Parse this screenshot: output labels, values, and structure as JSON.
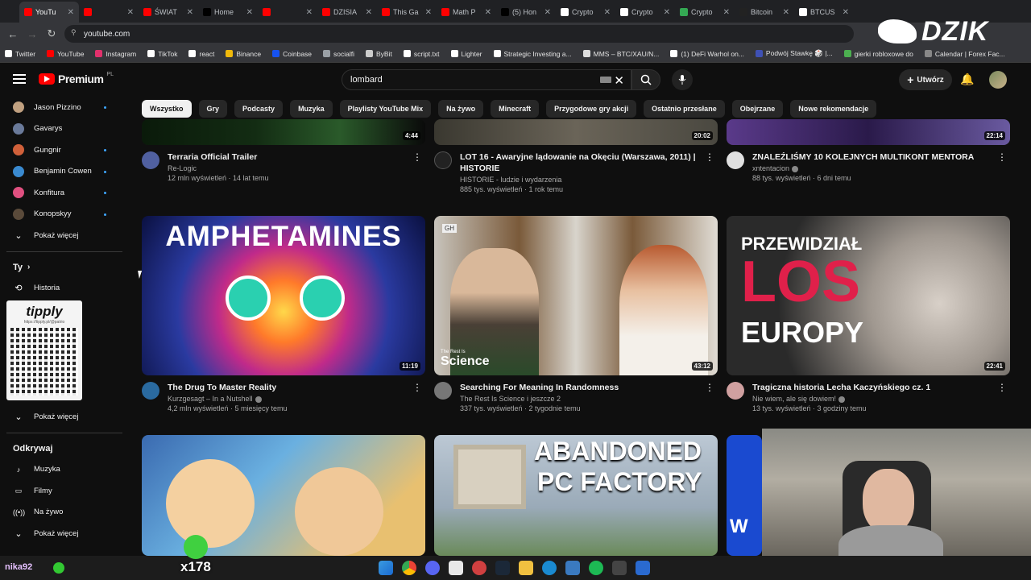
{
  "browser": {
    "tabs": [
      {
        "label": "YouTu",
        "color": "#ff0000",
        "active": true
      },
      {
        "label": "",
        "color": "#ff0000",
        "active": false
      },
      {
        "label": "ŚWIAT",
        "color": "#ff0000",
        "active": false
      },
      {
        "label": "Home",
        "color": "#000000",
        "active": false
      },
      {
        "label": "",
        "color": "#ff0000",
        "active": false
      },
      {
        "label": "DZISIA",
        "color": "#ff0000",
        "active": false
      },
      {
        "label": "This Ga",
        "color": "#ff0000",
        "active": false
      },
      {
        "label": "Math P",
        "color": "#ff0000",
        "active": false
      },
      {
        "label": "(5) Hon",
        "color": "#000000",
        "active": false
      },
      {
        "label": "Crypto",
        "color": "#ffffff",
        "active": false
      },
      {
        "label": "Crypto",
        "color": "#ffffff",
        "active": false
      },
      {
        "label": "Crypto",
        "color": "#34a853",
        "active": false
      },
      {
        "label": "Bitcoin",
        "color": "#222222",
        "active": false
      },
      {
        "label": "BTCUS",
        "color": "#ffffff",
        "active": false
      }
    ],
    "url": "youtube.com",
    "bookmarks": [
      {
        "label": "Twitter",
        "color": "#ffffff"
      },
      {
        "label": "YouTube",
        "color": "#ff0000"
      },
      {
        "label": "Instagram",
        "color": "#e1306c"
      },
      {
        "label": "TikTok",
        "color": "#ffffff"
      },
      {
        "label": "react",
        "color": "#ffffff"
      },
      {
        "label": "Binance",
        "color": "#f0b90b"
      },
      {
        "label": "Coinbase",
        "color": "#1652f0"
      },
      {
        "label": "socialfi",
        "color": "#9aa0a6"
      },
      {
        "label": "ByBit",
        "color": "#cccccc"
      },
      {
        "label": "script.txt",
        "color": "#ffffff"
      },
      {
        "label": "Lighter",
        "color": "#ffffff"
      },
      {
        "label": "Strategic Investing a...",
        "color": "#ffffff"
      },
      {
        "label": "MMS – BTC/XAU/N...",
        "color": "#dddddd"
      },
      {
        "label": "(1) DeFi Warhol on...",
        "color": "#ffffff"
      },
      {
        "label": "Podwój Stawkę 🎲 |...",
        "color": "#3f51b5"
      },
      {
        "label": "gierki robloxowe do",
        "color": "#4caf50"
      },
      {
        "label": "Calendar | Forex Fac...",
        "color": "#888888"
      }
    ]
  },
  "overlay": {
    "brand": "DZIK",
    "nick": "nika92",
    "count": "x178",
    "qr_title": "tipply",
    "qr_url": "https://tipply.pl/@patrio"
  },
  "youtube": {
    "logo_word": "Premium",
    "logo_region": "PL",
    "search_value": "lombard",
    "create_label": "Utwórz",
    "subscriptions": [
      {
        "name": "Jason Pizzino",
        "color": "#c0a080",
        "dot": true
      },
      {
        "name": "Gavarys",
        "color": "#6a7a9a",
        "dot": false
      },
      {
        "name": "Gungnir",
        "color": "#d0603a",
        "dot": true
      },
      {
        "name": "Benjamin Cowen",
        "color": "#3a8ad0",
        "dot": true
      },
      {
        "name": "Konfitura",
        "color": "#e05080",
        "dot": true
      },
      {
        "name": "Konopskyy",
        "color": "#5a4a3a",
        "dot": true
      }
    ],
    "show_more": "Pokaż więcej",
    "you_title": "Ty",
    "you_items": [
      {
        "label": "Historia",
        "icon": "⟲"
      }
    ],
    "show_more_2": "Pokaż więcej",
    "explore_title": "Odkrywaj",
    "explore_items": [
      {
        "label": "Muzyka",
        "icon": "♪"
      },
      {
        "label": "Filmy",
        "icon": "▭"
      },
      {
        "label": "Na żywo",
        "icon": "((•))"
      }
    ],
    "show_more_3": "Pokaż więcej",
    "chips": [
      "Wszystko",
      "Gry",
      "Podcasty",
      "Muzyka",
      "Playlisty YouTube Mix",
      "Na żywo",
      "Minecraft",
      "Przygodowe gry akcji",
      "Ostatnio przesłane",
      "Obejrzane",
      "Nowe rekomendacje"
    ],
    "row1": [
      {
        "duration": "4:44",
        "title": "Terraria Official Trailer",
        "title2": "",
        "channel": "Re-Logic",
        "verified": false,
        "stats": "12 mln wyświetleń · 14 lat temu",
        "avatar": "#5060a0"
      },
      {
        "duration": "20:02",
        "title": "LOT 16 - Awaryjne lądowanie na Okęciu (Warszawa, 2011) |",
        "title2": "HISTORIE",
        "channel": "HISTORIE - ludzie i wydarzenia",
        "verified": false,
        "stats": "885 tys. wyświetleń · 1 rok temu",
        "avatar": "#222222"
      },
      {
        "duration": "22:14",
        "title": "ZNALEŹLIŚMY 10 KOLEJNYCH MULTIKONT MENTORA",
        "title2": "",
        "channel": "xntentacion",
        "verified": true,
        "stats": "88 tys. wyświetleń · 6 dni temu",
        "avatar": "#e0e0e0"
      }
    ],
    "row2": [
      {
        "duration": "11:19",
        "title": "The Drug To Master Reality",
        "channel": "Kurzgesagt – In a Nutshell",
        "verified": true,
        "stats": "4,2 mln wyświetleń · 5 miesięcy temu",
        "avatar": "#2a6aa0",
        "thumb_text": "AMPHETAMINES"
      },
      {
        "duration": "43:12",
        "title": "Searching For Meaning In Randomness",
        "channel": "The Rest Is Science i jeszcze 2",
        "verified": false,
        "stats": "337 tys. wyświetleń · 2 tygodnie temu",
        "avatar": "#777777",
        "thumb_small": "The Rest Is",
        "thumb_text": "Science",
        "thumb_logo": "GH"
      },
      {
        "duration": "22:41",
        "title": "Tragiczna historia Lecha Kaczyńskiego cz. 1",
        "channel": "Nie wiem, ale się dowiem!",
        "verified": true,
        "stats": "13 tys. wyświetleń · 3 godziny temu",
        "avatar": "#d0a0a0",
        "thumb_line1": "PRZEWIDZIAŁ",
        "thumb_line2": "LOS",
        "thumb_line3": "EUROPY"
      }
    ],
    "row3": [
      {
        "thumb_text": ""
      },
      {
        "thumb_line1": "ABANDONED",
        "thumb_line2": "PC FACTORY"
      },
      {
        "thumb_text": "W"
      }
    ]
  }
}
